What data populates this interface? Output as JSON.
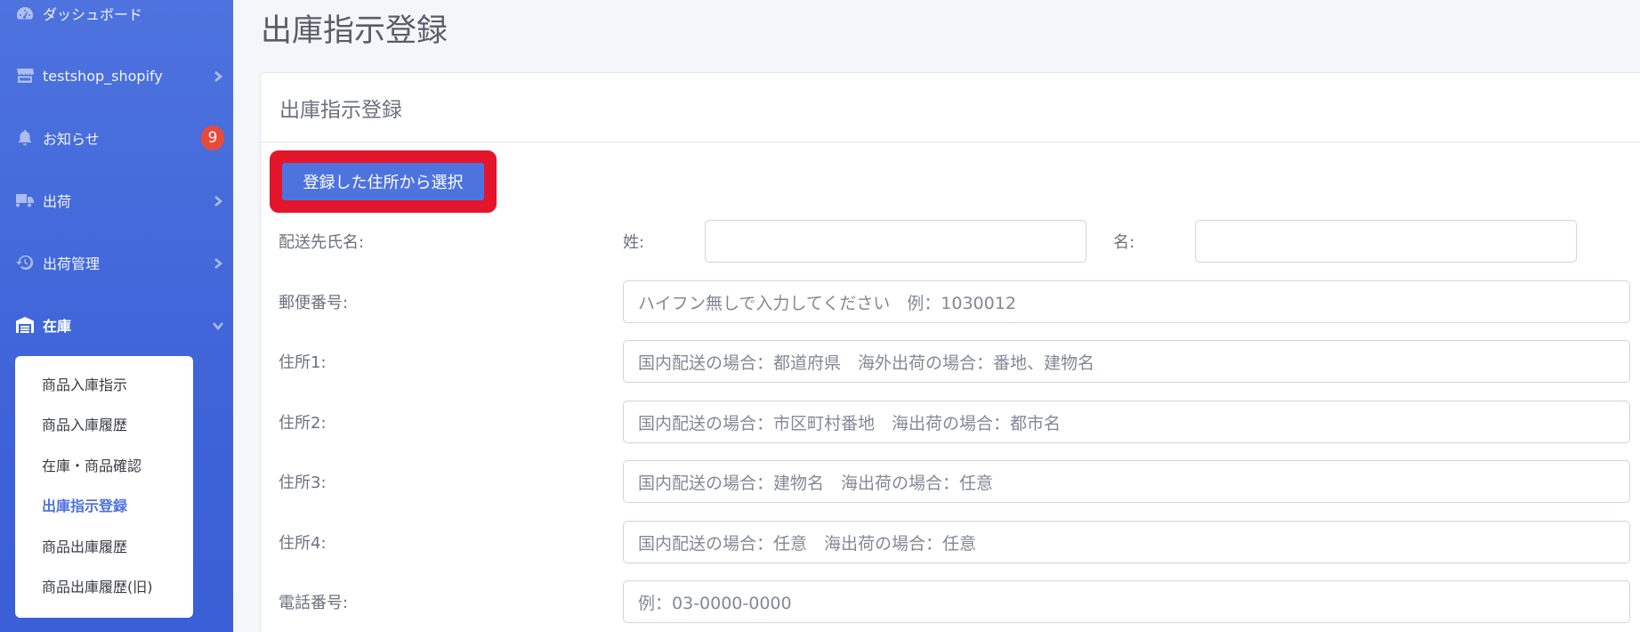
{
  "sidebar": {
    "items": [
      {
        "label": "ダッシュボード",
        "icon": "dashboard-icon"
      },
      {
        "label": "testshop_shopify",
        "icon": "store-icon"
      },
      {
        "label": "お知らせ",
        "icon": "bell-icon",
        "badge": "9"
      },
      {
        "label": "出荷",
        "icon": "truck-icon"
      },
      {
        "label": "出荷管理",
        "icon": "history-icon"
      },
      {
        "label": "在庫",
        "icon": "warehouse-icon"
      }
    ],
    "submenu": [
      {
        "label": "商品入庫指示"
      },
      {
        "label": "商品入庫履歴"
      },
      {
        "label": "在庫・商品確認"
      },
      {
        "label": "出庫指示登録"
      },
      {
        "label": "商品出庫履歴"
      },
      {
        "label": "商品出庫履歴(旧)"
      }
    ]
  },
  "main": {
    "page_title": "出庫指示登録",
    "card_title": "出庫指示登録",
    "select_address_label": "登録した住所から選択",
    "form": {
      "recipient_label": "配送先氏名:",
      "last_name_label": "姓:",
      "first_name_label": "名:",
      "postal_label": "郵便番号:",
      "postal_placeholder": "ハイフン無しで入力してください　例：1030012",
      "address1_label": "住所1:",
      "address1_placeholder": "国内配送の場合：都道府県　海外出荷の場合：番地、建物名",
      "address2_label": "住所2:",
      "address2_placeholder": "国内配送の場合：市区町村番地　海出荷の場合：都市名",
      "address3_label": "住所3:",
      "address3_placeholder": "国内配送の場合：建物名　海出荷の場合：任意",
      "address4_label": "住所4:",
      "address4_placeholder": "国内配送の場合：任意　海出荷の場合：任意",
      "phone_label": "電話番号:",
      "phone_placeholder": "例：03-0000-0000"
    }
  },
  "colors": {
    "sidebar": "#4e73df",
    "accent": "#4e73df",
    "badge": "#e74a3b",
    "highlight": "#e3152b"
  }
}
